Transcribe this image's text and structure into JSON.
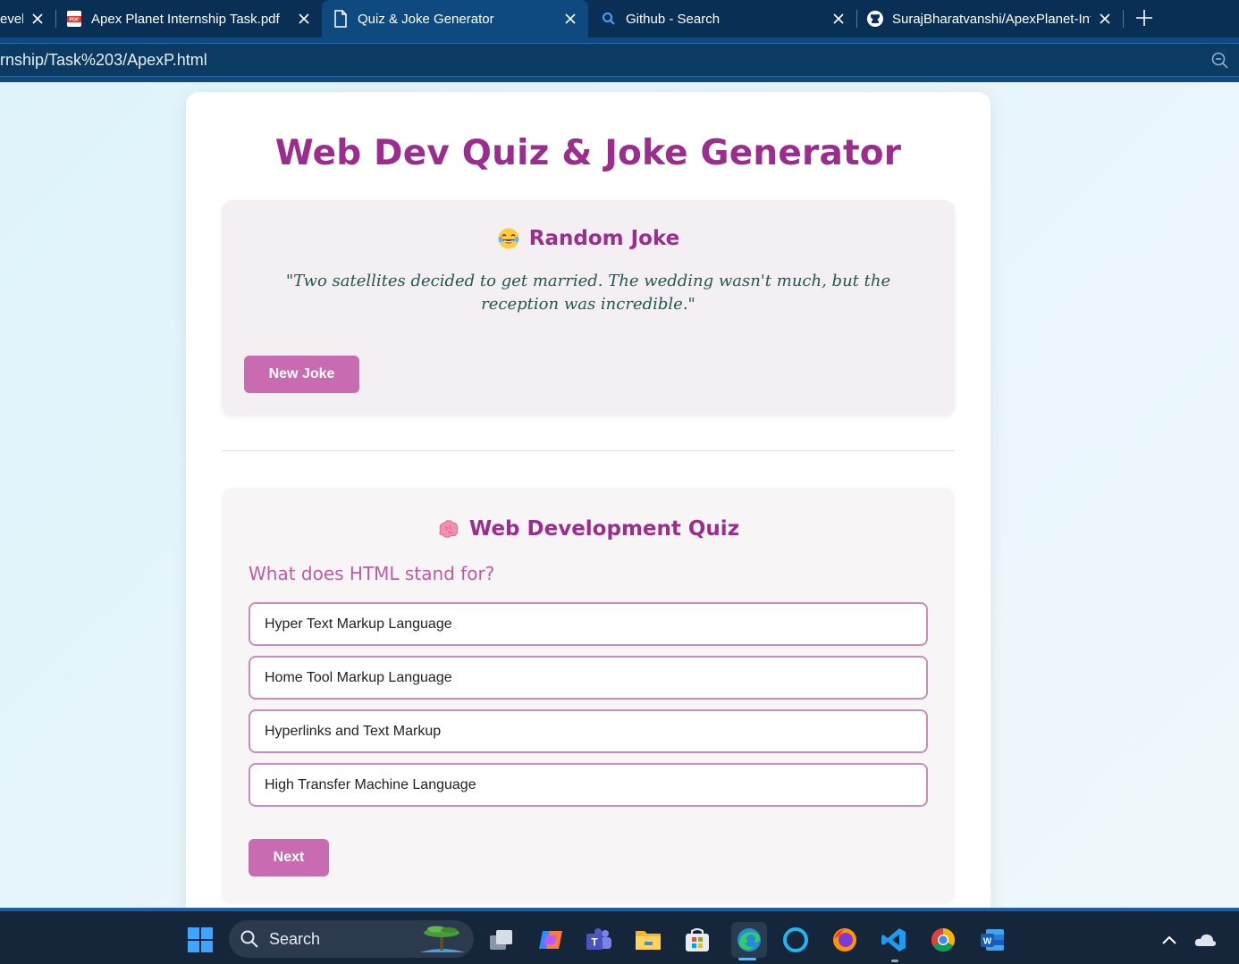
{
  "browser": {
    "tabs": [
      {
        "label": "evel",
        "icon": "close-icon"
      },
      {
        "label": "Apex Planet Internship Task.pdf",
        "icon": "pdf-icon"
      },
      {
        "label": "Quiz & Joke Generator",
        "icon": "document-icon"
      },
      {
        "label": "Github - Search",
        "icon": "search-icon"
      },
      {
        "label": "SurajBharatvanshi/ApexPlanet-Int",
        "icon": "github-icon"
      }
    ],
    "address": "rnship/Task%203/ApexP.html"
  },
  "page": {
    "title": "Web Dev Quiz & Joke Generator",
    "joke": {
      "heading": "Random Joke",
      "heading_icon": "laughing-emoji-icon",
      "text": "\"Two satellites decided to get married. The wedding wasn't much, but the reception was incredible.\"",
      "button": "New Joke"
    },
    "quiz": {
      "heading": "Web Development Quiz",
      "heading_icon": "brain-emoji-icon",
      "question": "What does HTML stand for?",
      "options": [
        "Hyper Text Markup Language",
        "Home Tool Markup Language",
        "Hyperlinks and Text Markup",
        "High Transfer Machine Language"
      ],
      "next_button": "Next"
    }
  },
  "taskbar": {
    "search_label": "Search",
    "apps": [
      "start-icon",
      "task-view-icon",
      "copilot-icon",
      "teams-icon",
      "file-explorer-icon",
      "microsoft-store-icon",
      "edge-icon",
      "cortana-icon",
      "firefox-icon",
      "vscode-icon",
      "chrome-icon",
      "word-icon"
    ]
  },
  "colors": {
    "accent": "#9b2d8e",
    "button": "#c96bb0",
    "joke_text": "#1d5a4f"
  }
}
